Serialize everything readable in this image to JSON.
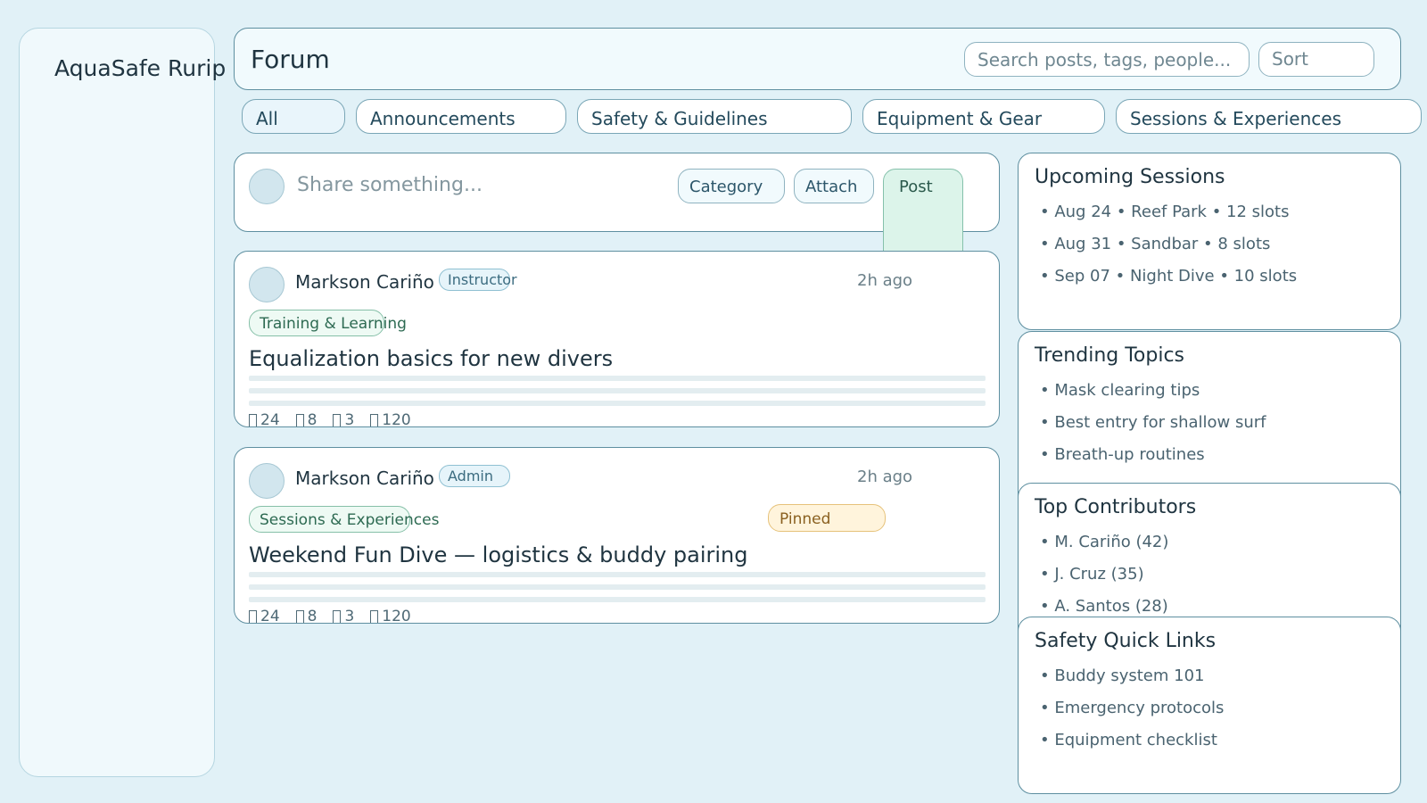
{
  "app": {
    "brand": "AquaSafe Rurip"
  },
  "header": {
    "title": "Forum",
    "search_placeholder": "Search posts, tags, people...",
    "sort_label": "Sort"
  },
  "tabs": [
    {
      "label": "All"
    },
    {
      "label": "Announcements"
    },
    {
      "label": "Safety & Guidelines"
    },
    {
      "label": "Equipment & Gear"
    },
    {
      "label": "Sessions & Experiences"
    }
  ],
  "composer": {
    "placeholder": "Share something...",
    "category_label": "Category",
    "attach_label": "Attach",
    "post_label": "Post"
  },
  "posts": [
    {
      "author": "Markson Cariño",
      "role": "Instructor",
      "time": "2h ago",
      "category": "Training & Learning",
      "pinned": "",
      "title": "Equalization basics for new divers",
      "likes": "24",
      "comments": "8",
      "shares": "3",
      "views": "120"
    },
    {
      "author": "Markson Cariño",
      "role": "Admin",
      "time": "2h ago",
      "category": "Sessions & Experiences",
      "pinned": "Pinned",
      "title": "Weekend Fun Dive — logistics & buddy pairing",
      "likes": "24",
      "comments": "8",
      "shares": "3",
      "views": "120"
    }
  ],
  "sidebar_cards": [
    {
      "title": "Upcoming Sessions",
      "items": [
        "• Aug 24 • Reef Park • 12 slots",
        "• Aug 31 • Sandbar • 8 slots",
        "• Sep 07 • Night Dive • 10 slots"
      ]
    },
    {
      "title": "Trending Topics",
      "items": [
        "• Mask clearing tips",
        "• Best entry for shallow surf",
        "• Breath-up routines"
      ]
    },
    {
      "title": "Top Contributors",
      "items": [
        "• M. Cariño (42)",
        "• J. Cruz (35)",
        "• A. Santos (28)"
      ]
    },
    {
      "title": "Safety Quick Links",
      "items": [
        "• Buddy system 101",
        "• Emergency protocols",
        "• Equipment checklist"
      ]
    }
  ],
  "icons": {
    "stat_glyph": "missing-glyph-icon"
  },
  "colors": {
    "background": "#e1f1f7",
    "border": "#5e8fa0",
    "accent_green": "#2d6a52",
    "pinned": "#fff4dc"
  }
}
